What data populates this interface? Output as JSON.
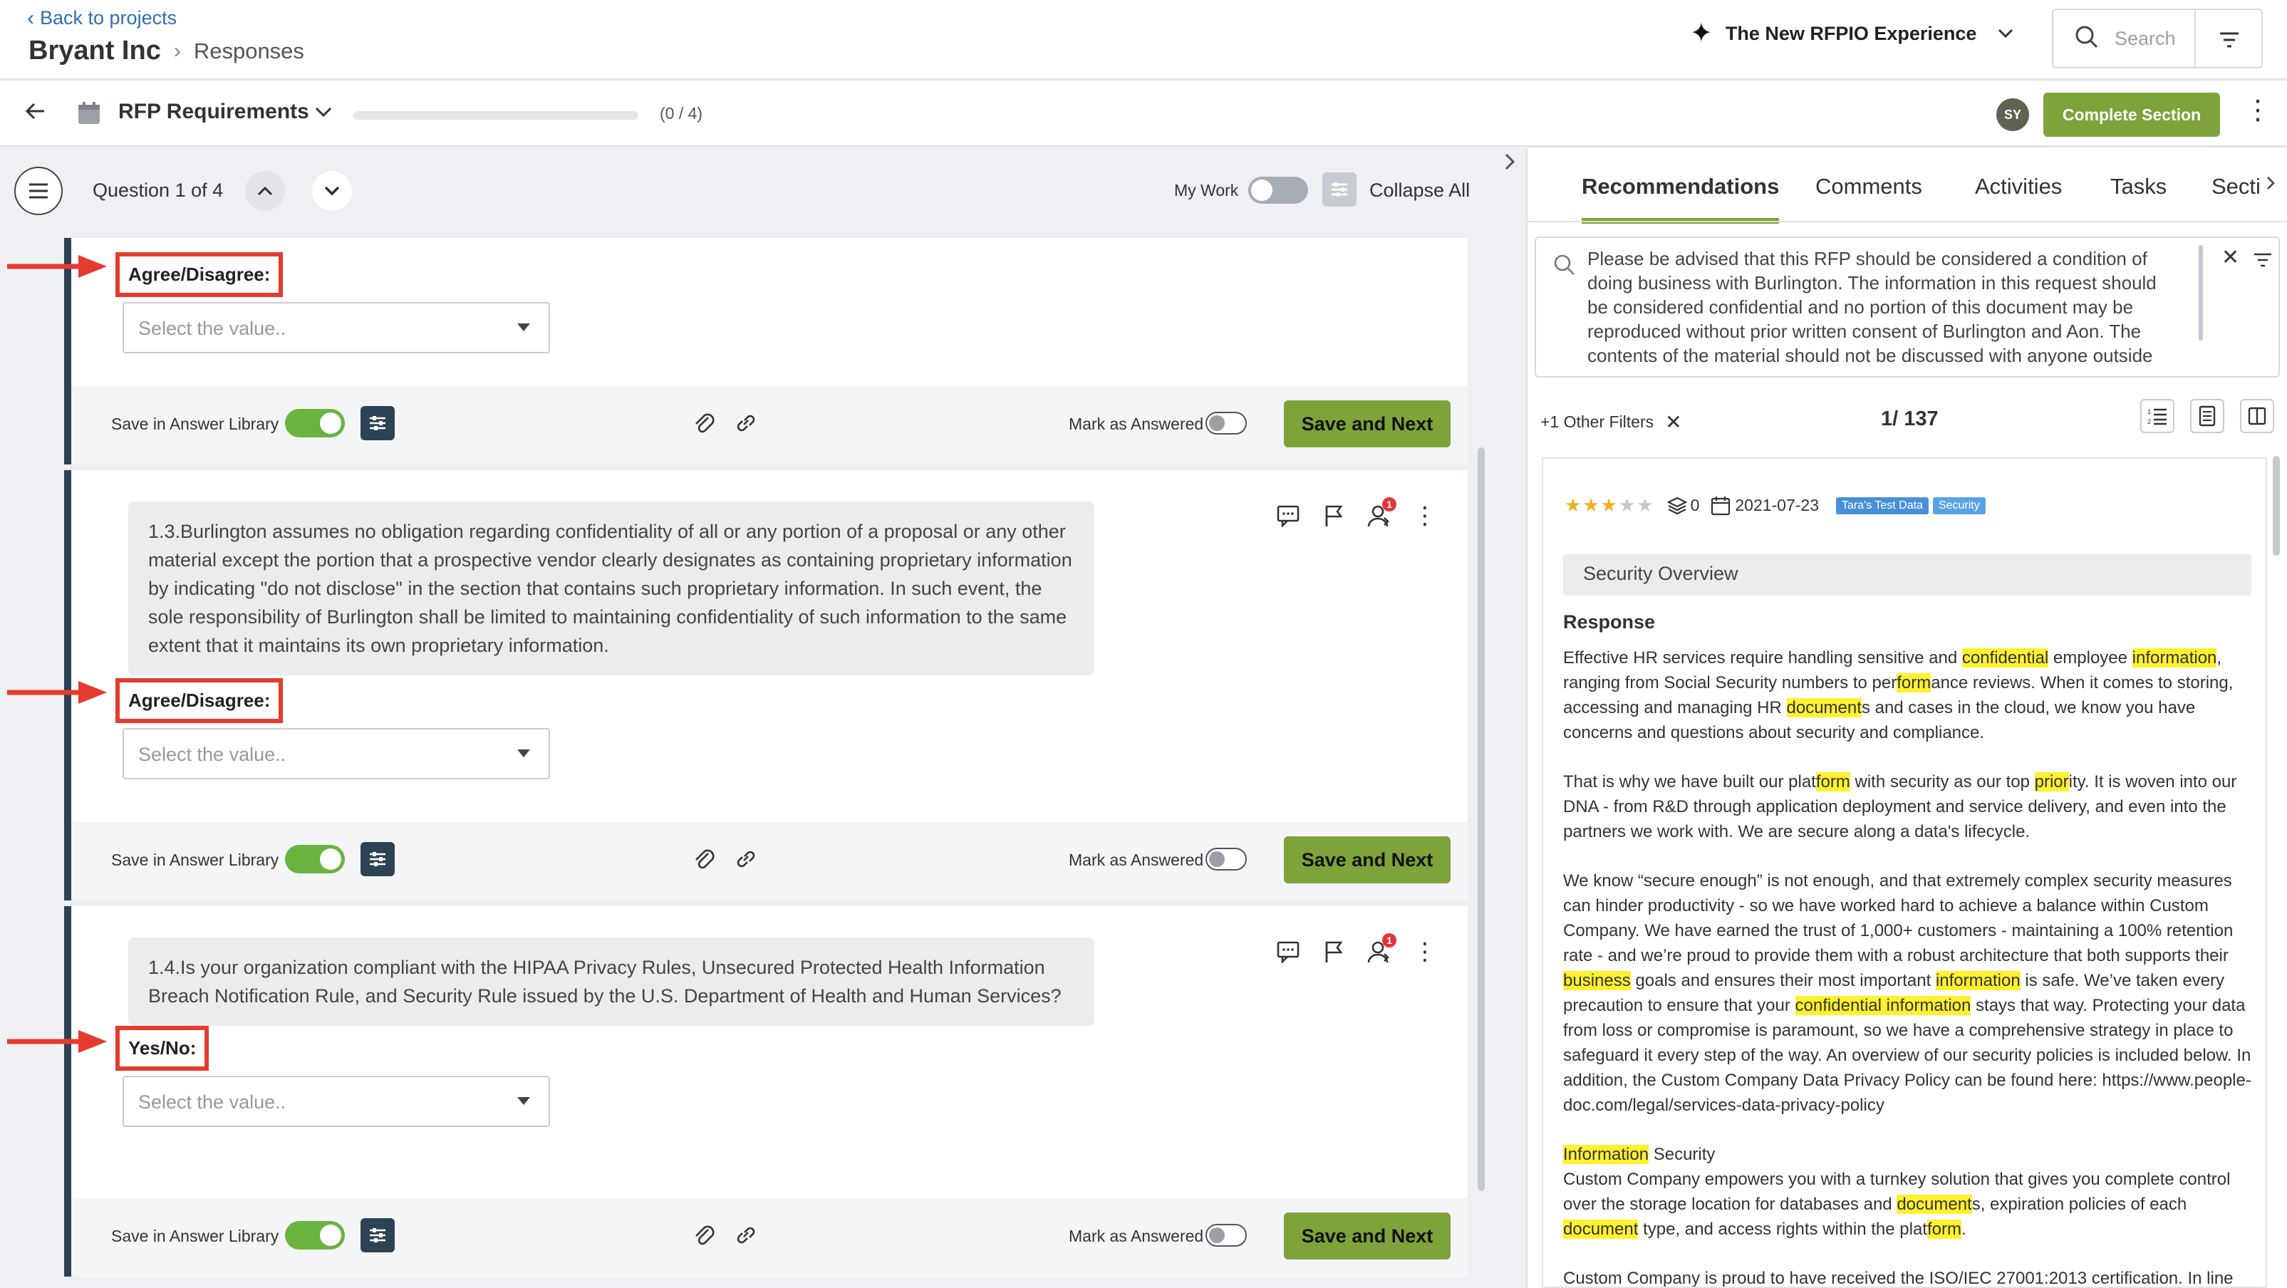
{
  "header": {
    "back_label": "Back to projects",
    "project": "Bryant Inc",
    "page": "Responses",
    "experience_label": "The New RFPIO Experience",
    "search_placeholder": "Search"
  },
  "section_bar": {
    "title": "RFP Requirements",
    "progress_text": "(0 / 4)",
    "progress_fraction": 0,
    "avatar_initials": "SY",
    "complete_label": "Complete Section"
  },
  "question_nav": {
    "counter": "Question 1 of 4",
    "my_work_label": "My Work",
    "collapse_label": "Collapse All"
  },
  "cards": [
    {
      "question": "",
      "answer_label": "Agree/Disagree:",
      "placeholder": "Select the value.."
    },
    {
      "question": "1.3.Burlington assumes no obligation regarding confidentiality of all or any portion of a proposal or any other material except the portion that a prospective vendor clearly designates as containing proprietary information by indicating \"do not disclose\" in the section that contains such proprietary information. In such event, the sole responsibility of Burlington shall be limited to maintaining confidentiality of such information to the same extent that it maintains its own proprietary information.",
      "answer_label": "Agree/Disagree:",
      "placeholder": "Select the value..",
      "assign_badge": "1"
    },
    {
      "question": "1.4.Is your organization compliant with the HIPAA Privacy Rules, Unsecured Protected Health Information Breach Notification Rule, and Security Rule issued by the U.S. Department of Health and Human Services?",
      "answer_label": "Yes/No:",
      "placeholder": "Select the value..",
      "assign_badge": "1"
    }
  ],
  "card_footer": {
    "save_library_label": "Save in Answer Library",
    "mark_answered_label": "Mark as Answered",
    "save_next_label": "Save and Next"
  },
  "right": {
    "tabs": [
      "Recommendations",
      "Comments",
      "Activities",
      "Tasks",
      "Secti"
    ],
    "search_text": "Please be advised that this RFP should be considered a condition of doing business with Burlington. The information in this request should be considered confidential and no portion of this document may be reproduced without prior written consent of Burlington and Aon. The contents of the material should not be discussed with anyone outside",
    "filters_label": "+1 Other Filters",
    "page_count": "1/ 137",
    "rec": {
      "rating": 3,
      "rating_max": 5,
      "uses": "0",
      "date": "2021-07-23",
      "tags": [
        {
          "label": "Tara's Test Data",
          "color": "#4a90d9"
        },
        {
          "label": "Security",
          "color": "#5aa2e6"
        }
      ],
      "title": "Security Overview",
      "response_label": "Response",
      "paragraphs": [
        "Effective HR services require handling sensitive and [[confidential]] employee [[information]], ranging from Social Security numbers to per[[form]]ance reviews. When it comes to storing, accessing and managing HR [[document]]s and cases in the cloud, we know you have concerns and questions about security and compliance.",
        "That is why we have built our plat[[form]] with security as our top [[prior]]ity. It is woven into our DNA - from R&D through application deployment and service delivery, and even into the partners we work with. We are secure along a data's lifecycle.",
        "We know “secure enough” is not enough, and that extremely complex security measures can hinder productivity - so we have worked hard to achieve a balance within Custom Company. We have earned the trust of 1,000+ customers - maintaining a 100% retention rate - and we’re proud to provide them with a robust architecture that both supports their [[business]] goals and ensures their most important [[information]] is safe. We’ve taken every precaution to ensure that your [[confidential information]] stays that way. Protecting your data from loss or compromise is paramount, so we have a comprehensive strategy in place to safeguard it every step of the way. An overview of our security policies is included below. In addition, the Custom Company Data Privacy Policy can be found here: https://www.people-doc.com/legal/services-data-privacy-policy",
        "[[Information]] Security\nCustom Company empowers you with a turnkey solution that gives you complete control over the storage location for databases and [[document]]s, expiration policies of each [[document]] type, and access rights within the plat[[form]].",
        "Custom Company is proud to have received the ISO/IEC 27001:2013 certification. In line"
      ]
    }
  },
  "colors": {
    "accent_green": "#7ea33a",
    "toggle_green": "#69b33f",
    "card_border": "#2d4254",
    "highlight": "#fff12e",
    "annotation_red": "#e53b2f"
  }
}
